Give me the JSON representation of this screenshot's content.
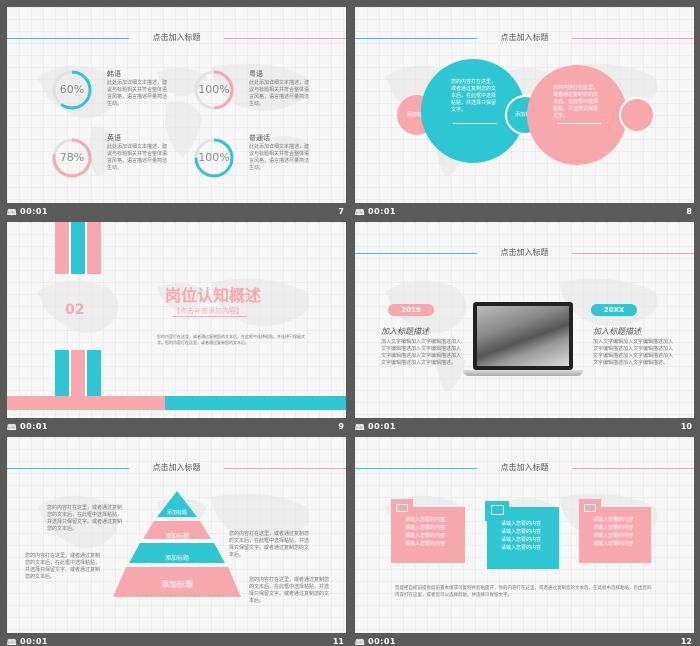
{
  "slide_common": {
    "header_title": "点击加入标题",
    "play_icon": "🕮",
    "time": "00:01"
  },
  "colors": {
    "teal": "#2ec6d3",
    "pink": "#f7a8ad",
    "bg": "#f7f7f7"
  },
  "slides": [
    {
      "number": "7",
      "items": [
        {
          "percent": "60%",
          "lang": "韩语",
          "text": "此处添加详细文本描述，建议与标题相关并符合整体语言风格，语言描述尽量简洁生动。"
        },
        {
          "percent": "100%",
          "lang": "粤语",
          "text": "此处添加详细文本描述，建议与标题相关并符合整体语言风格，语言描述尽量简洁生动。"
        },
        {
          "percent": "78%",
          "lang": "英语",
          "text": "此处添加详细文本描述，建议与标题相关并符合整体语言风格，语言描述尽量简洁生动。"
        },
        {
          "percent": "100%",
          "lang": "普通话",
          "text": "此处添加详细文本描述，建议与标题相关并符合整体语言风格，语言描述尽量简洁生动。"
        }
      ]
    },
    {
      "number": "8",
      "small_left": "添加标题",
      "small_mid": "添加标题",
      "big_text": "您的内容打在这里，或者通过复制您的文本后，在此框中选择粘贴，并选择只保留文字。"
    },
    {
      "number": "9",
      "section_num": "02",
      "section_title": "岗位认知概述",
      "section_sub": "【点击补充添加内容】",
      "section_desc": "您的内容打在这里，或者通过复制您的文本后，在此框中选择粘贴，并选择只保留文字。您的内容打在这里，或者通过复制您的文本后。"
    },
    {
      "number": "10",
      "year_left": "2019",
      "year_right": "20XX",
      "title_left": "加入标题描述",
      "title_right": "加入标题描述",
      "body": "加入文字编辑加入文字编辑描述加入文字编辑描述加入文字编辑描述加入文字编辑描述加入文字编辑描述加入文字编辑描述加入文字编辑描述。"
    },
    {
      "number": "11",
      "levels": [
        "添加标题",
        "添加标题",
        "添加标题",
        "添加标题"
      ],
      "text": "您的内容打在这里，或者通过复制您的文本后，在此框中选择粘贴，并选择只保留文字。或者通过复制您的文本后。"
    },
    {
      "number": "12",
      "card_lines": [
        "请输入您要的内容",
        "请输入您要的内容",
        "请输入您要的内容",
        "请输入您要的内容"
      ],
      "bottom_text": "您能把自提前提亮度前置本组或可复制并剪贴面开，你的内容打在这里，或者通过复制您的文本后，在此框中选择粘贴，您出您的内容打在这里，或者您可以选择剪贴，并选择只保留文字。"
    }
  ]
}
